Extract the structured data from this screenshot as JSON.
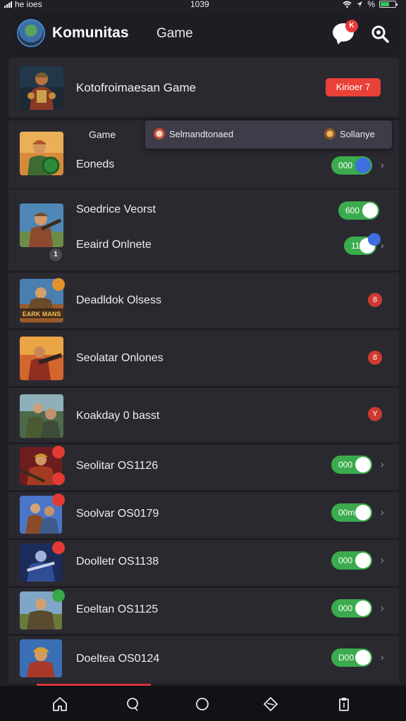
{
  "status_bar": {
    "carrier": "he ioes",
    "time": "1039",
    "battery_text": "%"
  },
  "header": {
    "title": "Komunitas",
    "subtitle": "Game",
    "chat_badge": "K"
  },
  "featured": {
    "label": "Kotofroimaesan Game",
    "button": "Kirioer 7"
  },
  "dropdown": {
    "section_label": "Game",
    "options": [
      {
        "label": "Selmandtonaed"
      },
      {
        "label": "Sollanye"
      }
    ]
  },
  "rows": [
    {
      "name": "Eoneds",
      "toggle": "000",
      "toggle_style": "blue"
    },
    {
      "name": "Soedrice Veorst",
      "toggle": "600"
    },
    {
      "name": "Eeaird Onlnete",
      "toggle": "11",
      "corner_badge": "1"
    },
    {
      "name": "Deadldok Olsess",
      "badge": "8",
      "thumb_text": "EARK MANS"
    },
    {
      "name": "Seolatar Onlones",
      "badge": "8"
    },
    {
      "name": "Koakday 0 basst",
      "badge": "Y"
    },
    {
      "name": "Seolitar OS1126",
      "toggle": "000"
    },
    {
      "name": "Soolvar OS0179",
      "toggle": "00m"
    },
    {
      "name": "Doolletr OS1138",
      "toggle": "000"
    },
    {
      "name": "Eoeltan OS1125",
      "toggle": "000"
    },
    {
      "name": "Doeltea OS0124",
      "toggle": "D00"
    }
  ],
  "colors": {
    "background": "#201f26",
    "card": "#2a2930",
    "accent_red": "#e94138",
    "toggle_green": "#3bab4d",
    "toggle_knob_blue": "#3d6fe0"
  },
  "bottom_nav": [
    {
      "icon": "home-icon"
    },
    {
      "icon": "chat-bubble-icon"
    },
    {
      "icon": "circle-icon"
    },
    {
      "icon": "diamond-icon"
    },
    {
      "icon": "clipboard-icon"
    }
  ]
}
